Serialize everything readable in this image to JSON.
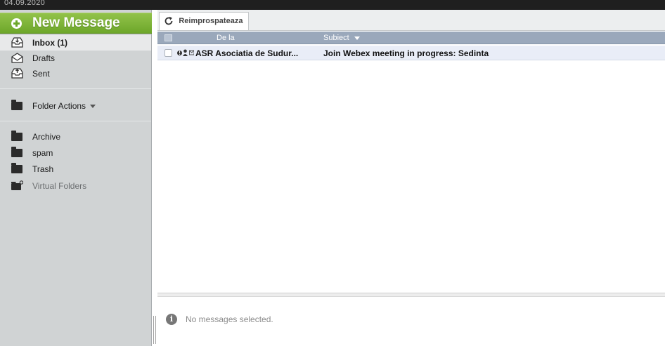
{
  "topbar": {
    "date": "04.09.2020"
  },
  "sidebar": {
    "new_message_label": "New Message",
    "mail_items": [
      {
        "label": "Inbox (1)",
        "icon": "inbox-icon"
      },
      {
        "label": "Drafts",
        "icon": "drafts-icon"
      },
      {
        "label": "Sent",
        "icon": "sent-icon"
      }
    ],
    "folder_actions_label": "Folder Actions",
    "folders": [
      {
        "label": "Archive",
        "icon": "folder-icon"
      },
      {
        "label": "spam",
        "icon": "folder-icon"
      },
      {
        "label": "Trash",
        "icon": "folder-icon"
      },
      {
        "label": "Virtual Folders",
        "icon": "virtual-folder-icon"
      }
    ]
  },
  "toolbar": {
    "refresh_label": "Reimprospateaza"
  },
  "list": {
    "headers": {
      "from": "De la",
      "subject": "Subiect"
    },
    "rows": [
      {
        "from": "ASR Asociatia de Sudur...",
        "subject": "Join Webex meeting in progress: Sedinta"
      }
    ]
  },
  "preview": {
    "empty_text": "No messages selected."
  },
  "colors": {
    "accent_green": "#6da72a",
    "header_blue": "#9aa8bb",
    "sidebar_bg": "#d0d3d4"
  }
}
